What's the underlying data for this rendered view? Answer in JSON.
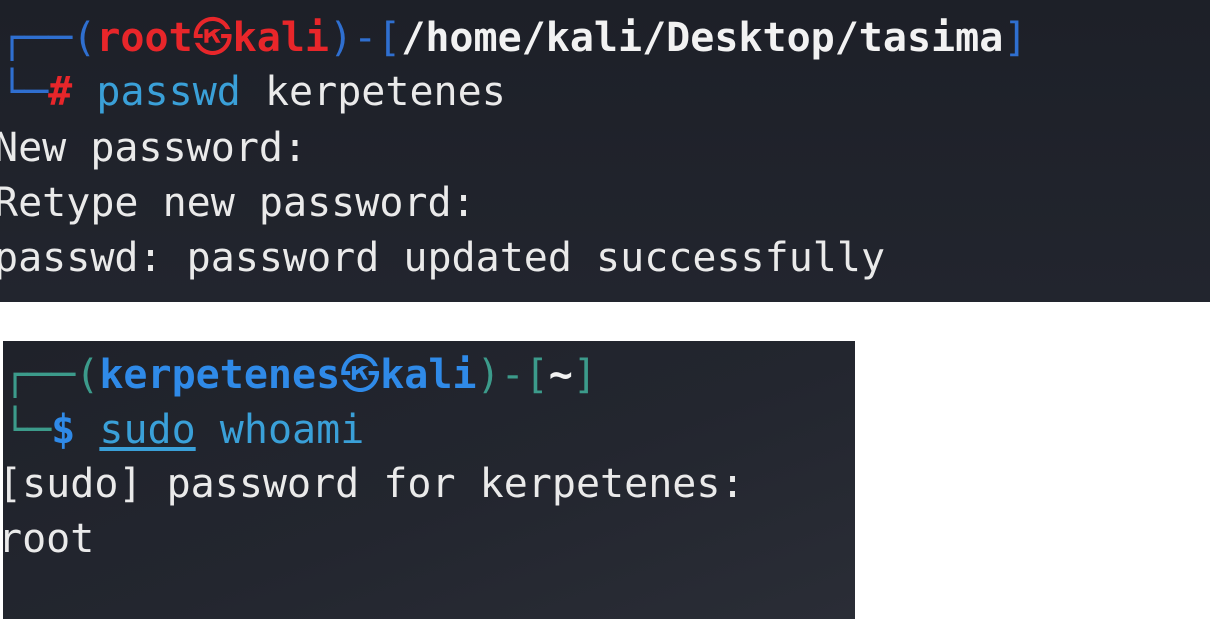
{
  "terminal_1": {
    "prompt": {
      "corner_top": "┌──",
      "open": "(",
      "user": "root",
      "symbol": "㉿",
      "host": "kali",
      "close": ")-[",
      "path": "/home/kali/Desktop/tasima",
      "path_close": "]",
      "corner_bottom": "└─",
      "sigil": "#"
    },
    "command": "passwd",
    "argument": "kerpetenes",
    "output": [
      "New password:",
      "Retype new password:",
      "passwd: password updated successfully"
    ],
    "colors": {
      "background": "#1e2129",
      "user": "#e8262a",
      "box": "#2f6fd0",
      "command": "#3aa0d8",
      "text": "#eaeaea"
    }
  },
  "terminal_2": {
    "prompt": {
      "corner_top": "┌──",
      "open": "(",
      "user": "kerpetenes",
      "symbol": "㉿",
      "host": "kali",
      "close": ")-[",
      "path": "~",
      "path_close": "]",
      "corner_bottom": "└─",
      "sigil": "$"
    },
    "command": "sudo",
    "argument": "whoami",
    "output": [
      "[sudo] password for kerpetenes:",
      "root"
    ],
    "colors": {
      "background": "#21242c",
      "user": "#2f8ae8",
      "box": "#3c9b8b",
      "command": "#3aa0d8",
      "text": "#eaeaea"
    }
  }
}
